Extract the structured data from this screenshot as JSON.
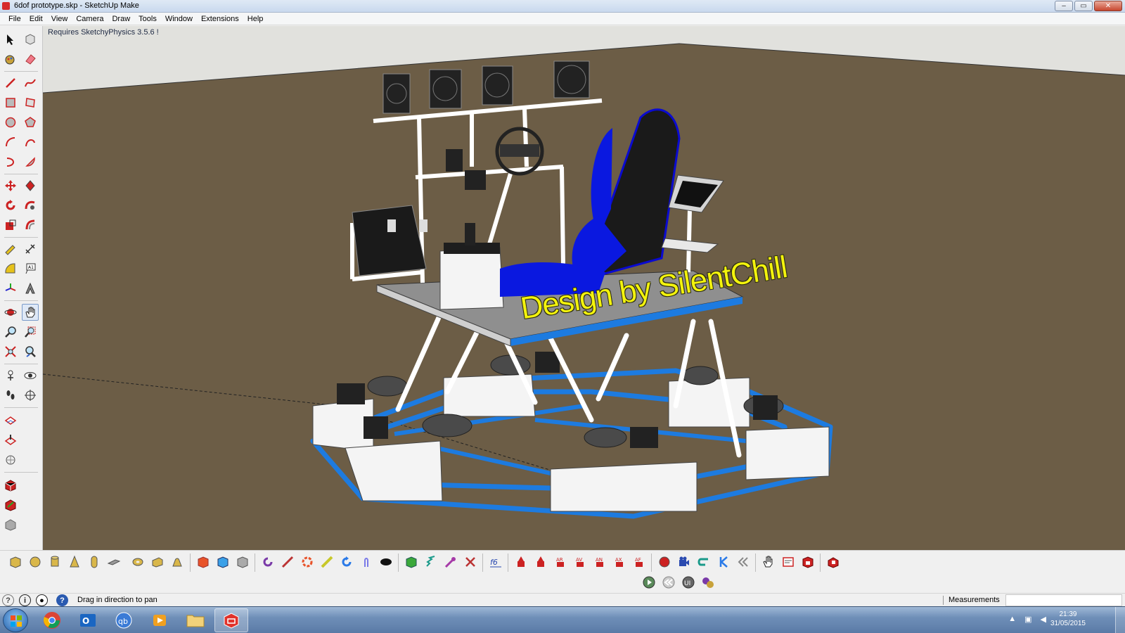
{
  "window": {
    "title": "6dof prototype.skp - SketchUp Make",
    "controls": [
      "–",
      "▭",
      "✕"
    ]
  },
  "menu": [
    "File",
    "Edit",
    "View",
    "Camera",
    "Draw",
    "Tools",
    "Window",
    "Extensions",
    "Help"
  ],
  "viewport": {
    "note": "Requires SketchyPhysics 3.5.6 !",
    "watermark": "Design by SilentChill"
  },
  "status": {
    "hint": "Drag in direction to pan",
    "measurements_label": "Measurements",
    "measurements_value": ""
  },
  "taskbar": {
    "time": "21:39",
    "date": "31/05/2015",
    "apps": [
      "chrome",
      "outlook",
      "qbittorrent",
      "media-player",
      "file-explorer",
      "sketchup"
    ]
  }
}
